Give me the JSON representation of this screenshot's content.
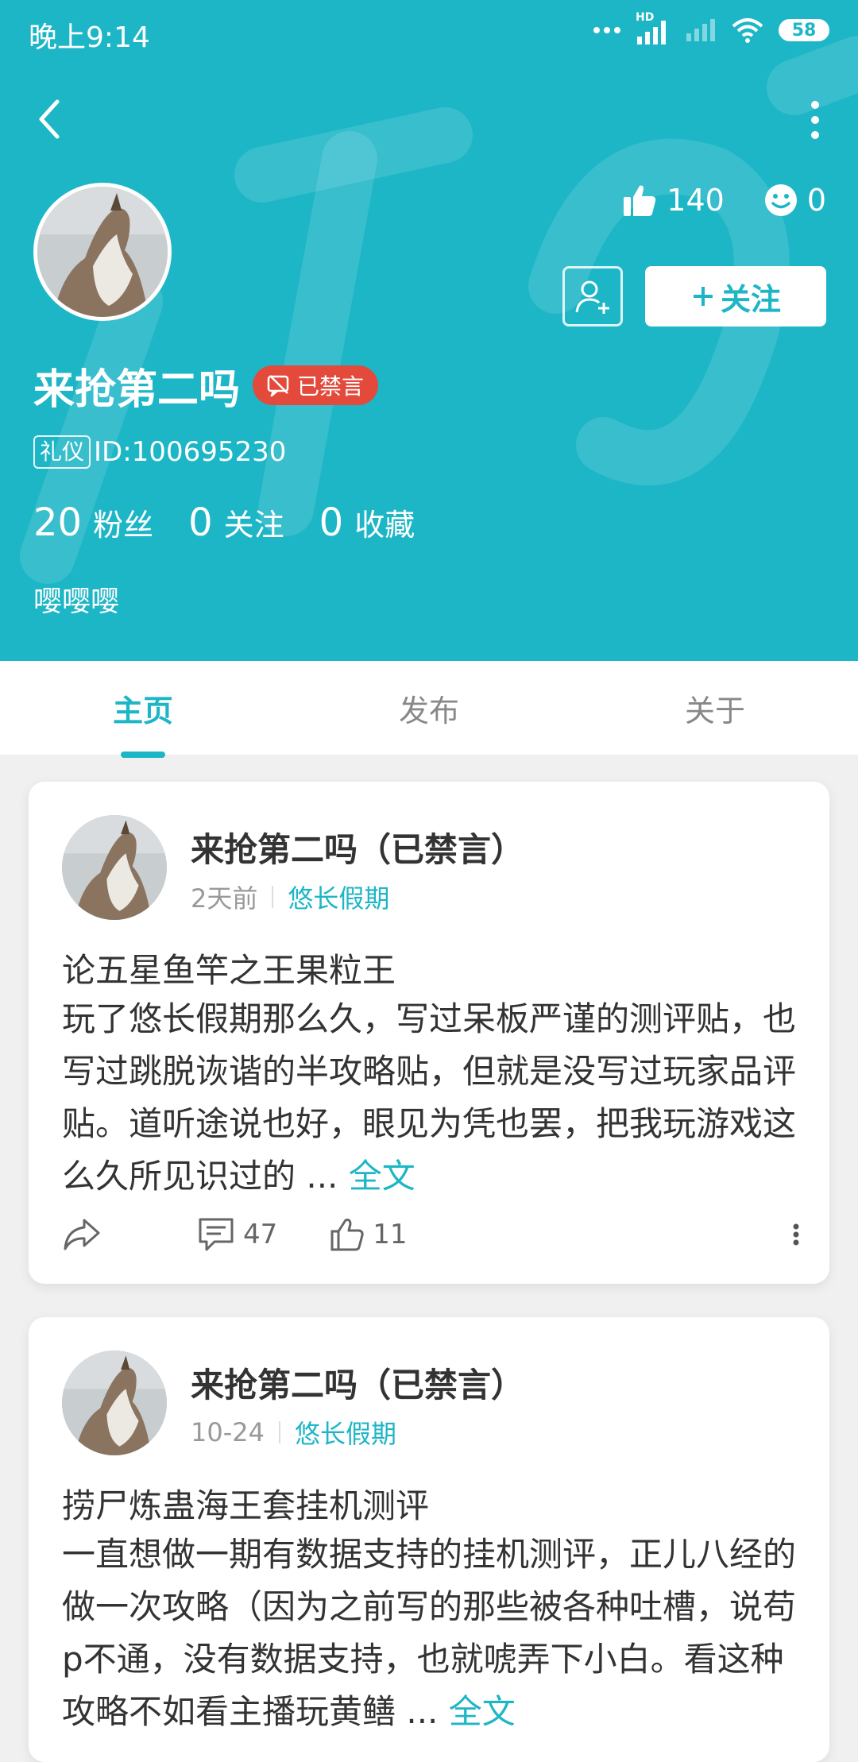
{
  "status_bar": {
    "time": "晚上9:14",
    "battery": "58",
    "network_label": "HD"
  },
  "profile": {
    "username": "来抢第二吗",
    "banned_badge": "已禁言",
    "level_tag": "礼仪",
    "user_id": "ID:100695230",
    "likes": "140",
    "smiles": "0",
    "follow_button": "关注",
    "stats": [
      {
        "num": "20",
        "label": "粉丝"
      },
      {
        "num": "0",
        "label": "关注"
      },
      {
        "num": "0",
        "label": "收藏"
      }
    ],
    "bio": "嘤嘤嘤"
  },
  "tabs": [
    {
      "label": "主页",
      "active": true
    },
    {
      "label": "发布",
      "active": false
    },
    {
      "label": "关于",
      "active": false
    }
  ],
  "posts": [
    {
      "author": "来抢第二吗（已禁言）",
      "time": "2天前",
      "topic": "悠长假期",
      "title": "论五星鱼竿之王果粒王",
      "body": "玩了悠长假期那么久，写过呆板严谨的测评贴，也写过跳脱诙谐的半攻略贴，但就是没写过玩家品评贴。道听途说也好，眼见为凭也罢，把我玩游戏这么久所见识过的 ...",
      "more": "全文",
      "comments": "47",
      "likes": "11"
    },
    {
      "author": "来抢第二吗（已禁言）",
      "time": "10-24",
      "topic": "悠长假期",
      "title": "捞尸炼蛊海王套挂机测评",
      "body": "一直想做一期有数据支持的挂机测评，正儿八经的做一次攻略（因为之前写的那些被各种吐槽，说苟p不通，没有数据支持，也就唬弄下小白。看这种攻略不如看主播玩黄鳝 ...",
      "more": "全文"
    }
  ]
}
